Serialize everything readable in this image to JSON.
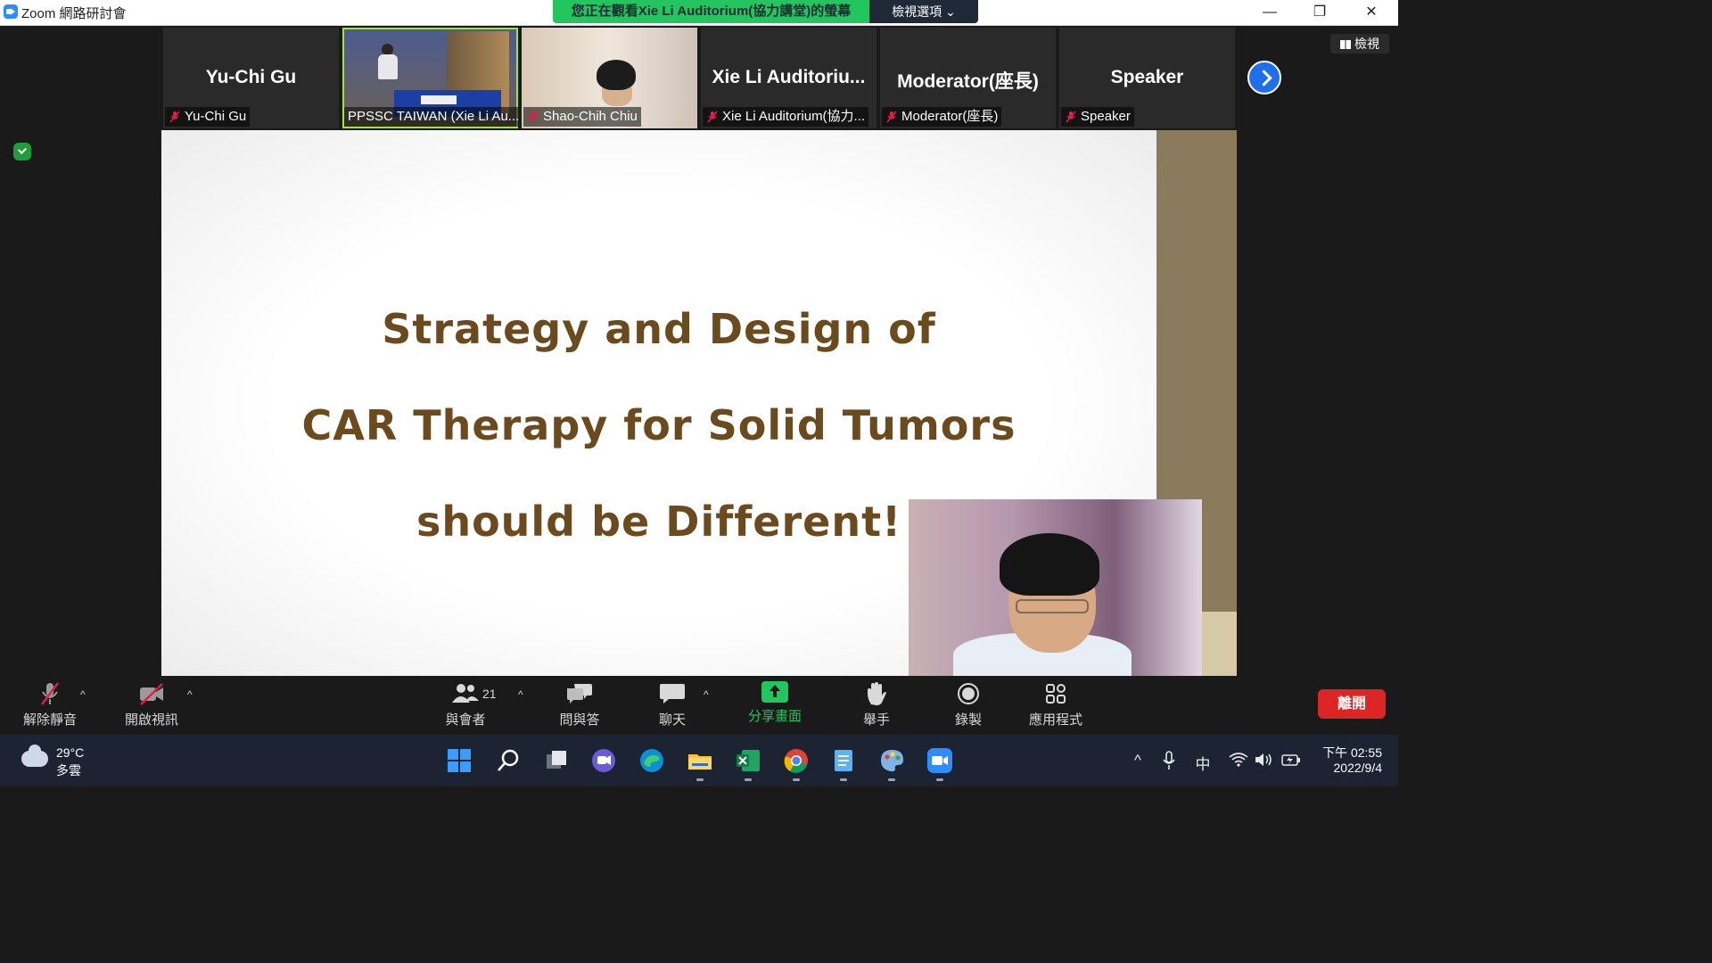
{
  "window": {
    "app_title": "Zoom 網路研討會",
    "share_banner": "您正在觀看Xie Li Auditorium(協力講堂)的螢幕",
    "view_options": "檢視選項 ⌄",
    "minimize": "—",
    "restore": "❐",
    "close": "✕"
  },
  "gallery": {
    "view_button": "檢視",
    "tiles": [
      {
        "big_name": "Yu-Chi Gu",
        "nameplate": "Yu-Chi Gu",
        "muted": true
      },
      {
        "big_name": "",
        "nameplate": "PPSSC TAIWAN (Xie Li Au...",
        "muted": false,
        "video": "room"
      },
      {
        "big_name": "",
        "nameplate": "Shao-Chih Chiu",
        "muted": true,
        "video": "face"
      },
      {
        "big_name": "Xie Li Auditoriu...",
        "nameplate": "Xie Li Auditorium(協力...",
        "muted": true
      },
      {
        "big_name": "Moderator(座長)",
        "nameplate": "Moderator(座長)",
        "muted": true
      },
      {
        "big_name": "Speaker",
        "nameplate": "Speaker",
        "muted": true
      }
    ]
  },
  "slide": {
    "line1": "Strategy and Design of",
    "line2": "CAR Therapy for Solid Tumors",
    "line3": "should be Different!"
  },
  "toolbar": {
    "unmute": "解除靜音",
    "start_video": "開啟視訊",
    "participants": "與會者",
    "participant_count": "21",
    "qa": "問與答",
    "chat": "聊天",
    "share_screen": "分享畫面",
    "raise_hand": "舉手",
    "record": "錄製",
    "apps": "應用程式",
    "leave": "離開",
    "caret": "^"
  },
  "taskbar": {
    "temperature": "29°C",
    "weather": "多雲",
    "ime": "中",
    "time": "下午 02:55",
    "date": "2022/9/4",
    "chevron": "^"
  },
  "colors": {
    "share_green": "#22c55e",
    "leave_red": "#dc2626",
    "slide_text": "#6b4a1e",
    "active_border": "#a3e635"
  }
}
